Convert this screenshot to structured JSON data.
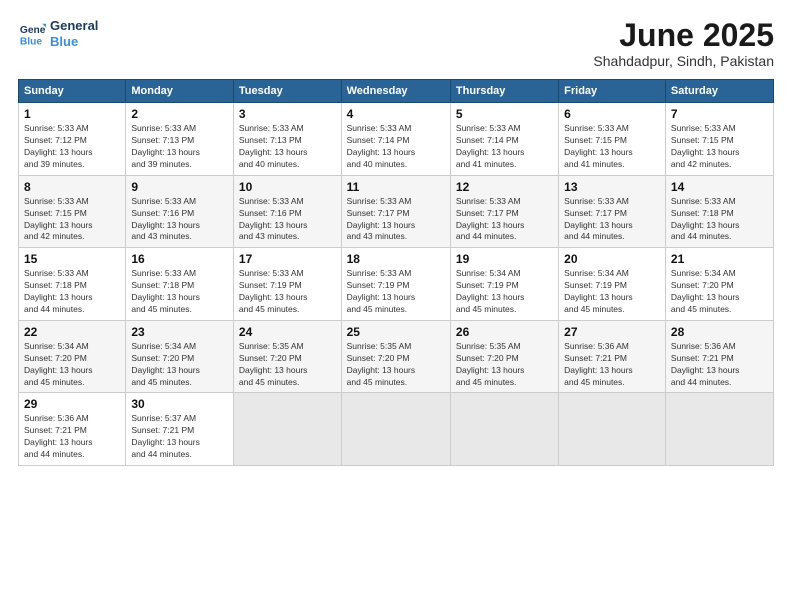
{
  "header": {
    "logo_line1": "General",
    "logo_line2": "Blue",
    "month_title": "June 2025",
    "location": "Shahdadpur, Sindh, Pakistan"
  },
  "columns": [
    "Sunday",
    "Monday",
    "Tuesday",
    "Wednesday",
    "Thursday",
    "Friday",
    "Saturday"
  ],
  "rows": [
    [
      {
        "day": "1",
        "info": "Sunrise: 5:33 AM\nSunset: 7:12 PM\nDaylight: 13 hours\nand 39 minutes."
      },
      {
        "day": "2",
        "info": "Sunrise: 5:33 AM\nSunset: 7:13 PM\nDaylight: 13 hours\nand 39 minutes."
      },
      {
        "day": "3",
        "info": "Sunrise: 5:33 AM\nSunset: 7:13 PM\nDaylight: 13 hours\nand 40 minutes."
      },
      {
        "day": "4",
        "info": "Sunrise: 5:33 AM\nSunset: 7:14 PM\nDaylight: 13 hours\nand 40 minutes."
      },
      {
        "day": "5",
        "info": "Sunrise: 5:33 AM\nSunset: 7:14 PM\nDaylight: 13 hours\nand 41 minutes."
      },
      {
        "day": "6",
        "info": "Sunrise: 5:33 AM\nSunset: 7:15 PM\nDaylight: 13 hours\nand 41 minutes."
      },
      {
        "day": "7",
        "info": "Sunrise: 5:33 AM\nSunset: 7:15 PM\nDaylight: 13 hours\nand 42 minutes."
      }
    ],
    [
      {
        "day": "8",
        "info": "Sunrise: 5:33 AM\nSunset: 7:15 PM\nDaylight: 13 hours\nand 42 minutes."
      },
      {
        "day": "9",
        "info": "Sunrise: 5:33 AM\nSunset: 7:16 PM\nDaylight: 13 hours\nand 43 minutes."
      },
      {
        "day": "10",
        "info": "Sunrise: 5:33 AM\nSunset: 7:16 PM\nDaylight: 13 hours\nand 43 minutes."
      },
      {
        "day": "11",
        "info": "Sunrise: 5:33 AM\nSunset: 7:17 PM\nDaylight: 13 hours\nand 43 minutes."
      },
      {
        "day": "12",
        "info": "Sunrise: 5:33 AM\nSunset: 7:17 PM\nDaylight: 13 hours\nand 44 minutes."
      },
      {
        "day": "13",
        "info": "Sunrise: 5:33 AM\nSunset: 7:17 PM\nDaylight: 13 hours\nand 44 minutes."
      },
      {
        "day": "14",
        "info": "Sunrise: 5:33 AM\nSunset: 7:18 PM\nDaylight: 13 hours\nand 44 minutes."
      }
    ],
    [
      {
        "day": "15",
        "info": "Sunrise: 5:33 AM\nSunset: 7:18 PM\nDaylight: 13 hours\nand 44 minutes."
      },
      {
        "day": "16",
        "info": "Sunrise: 5:33 AM\nSunset: 7:18 PM\nDaylight: 13 hours\nand 45 minutes."
      },
      {
        "day": "17",
        "info": "Sunrise: 5:33 AM\nSunset: 7:19 PM\nDaylight: 13 hours\nand 45 minutes."
      },
      {
        "day": "18",
        "info": "Sunrise: 5:33 AM\nSunset: 7:19 PM\nDaylight: 13 hours\nand 45 minutes."
      },
      {
        "day": "19",
        "info": "Sunrise: 5:34 AM\nSunset: 7:19 PM\nDaylight: 13 hours\nand 45 minutes."
      },
      {
        "day": "20",
        "info": "Sunrise: 5:34 AM\nSunset: 7:19 PM\nDaylight: 13 hours\nand 45 minutes."
      },
      {
        "day": "21",
        "info": "Sunrise: 5:34 AM\nSunset: 7:20 PM\nDaylight: 13 hours\nand 45 minutes."
      }
    ],
    [
      {
        "day": "22",
        "info": "Sunrise: 5:34 AM\nSunset: 7:20 PM\nDaylight: 13 hours\nand 45 minutes."
      },
      {
        "day": "23",
        "info": "Sunrise: 5:34 AM\nSunset: 7:20 PM\nDaylight: 13 hours\nand 45 minutes."
      },
      {
        "day": "24",
        "info": "Sunrise: 5:35 AM\nSunset: 7:20 PM\nDaylight: 13 hours\nand 45 minutes."
      },
      {
        "day": "25",
        "info": "Sunrise: 5:35 AM\nSunset: 7:20 PM\nDaylight: 13 hours\nand 45 minutes."
      },
      {
        "day": "26",
        "info": "Sunrise: 5:35 AM\nSunset: 7:20 PM\nDaylight: 13 hours\nand 45 minutes."
      },
      {
        "day": "27",
        "info": "Sunrise: 5:36 AM\nSunset: 7:21 PM\nDaylight: 13 hours\nand 45 minutes."
      },
      {
        "day": "28",
        "info": "Sunrise: 5:36 AM\nSunset: 7:21 PM\nDaylight: 13 hours\nand 44 minutes."
      }
    ],
    [
      {
        "day": "29",
        "info": "Sunrise: 5:36 AM\nSunset: 7:21 PM\nDaylight: 13 hours\nand 44 minutes."
      },
      {
        "day": "30",
        "info": "Sunrise: 5:37 AM\nSunset: 7:21 PM\nDaylight: 13 hours\nand 44 minutes."
      },
      {
        "day": "",
        "info": ""
      },
      {
        "day": "",
        "info": ""
      },
      {
        "day": "",
        "info": ""
      },
      {
        "day": "",
        "info": ""
      },
      {
        "day": "",
        "info": ""
      }
    ]
  ]
}
